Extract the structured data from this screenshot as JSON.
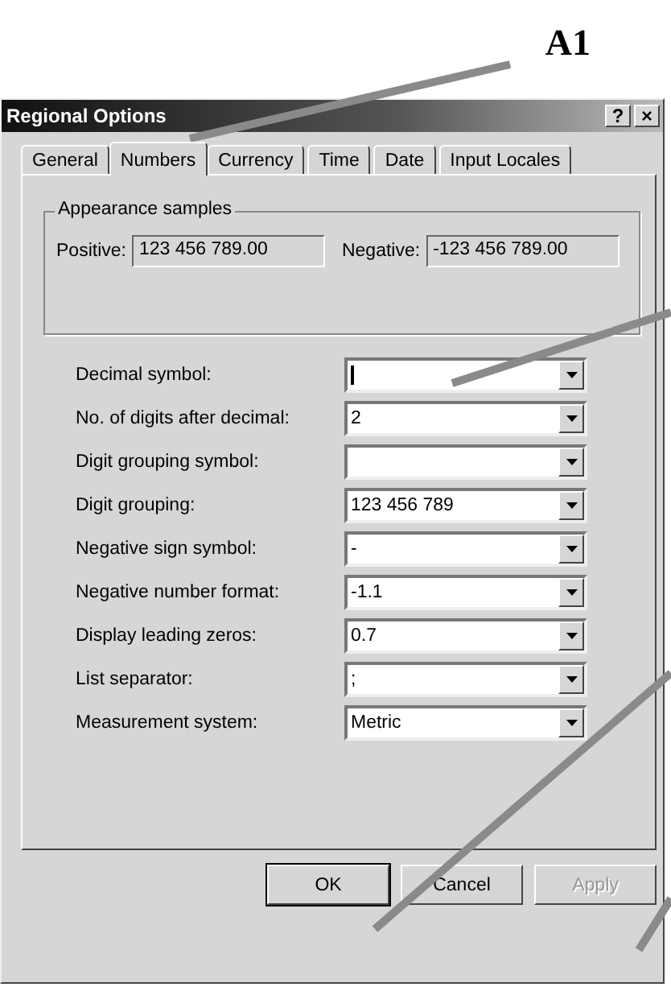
{
  "annotation": {
    "label": "A1"
  },
  "window": {
    "title": "Regional Options",
    "help_button": "?",
    "close_button": "×"
  },
  "tabs": [
    {
      "label": "General",
      "selected": false
    },
    {
      "label": "Numbers",
      "selected": true
    },
    {
      "label": "Currency",
      "selected": false
    },
    {
      "label": "Time",
      "selected": false
    },
    {
      "label": "Date",
      "selected": false
    },
    {
      "label": "Input Locales",
      "selected": false
    }
  ],
  "appearance_samples": {
    "title": "Appearance samples",
    "positive": {
      "label": "Positive:",
      "value": "123 456 789.00"
    },
    "negative": {
      "label": "Negative:",
      "value": "-123 456 789.00"
    }
  },
  "settings": [
    {
      "label": "Decimal symbol:",
      "focused": true
    },
    {
      "label": "No. of digits after decimal:",
      "value": "2",
      "focused": false
    },
    {
      "label": "Digit grouping symbol:",
      "focused": false
    },
    {
      "label": "Digit grouping:",
      "value": "123 456 789",
      "focused": false
    },
    {
      "label": "Negative sign symbol:",
      "value": "-",
      "focused": false
    },
    {
      "label": "Negative number format:",
      "value": "-1.1",
      "focused": false
    },
    {
      "label": "Display leading zeros:",
      "value": "0.7",
      "focused": false
    },
    {
      "label": "List separator:",
      "value": ";",
      "focused": false
    },
    {
      "label": "Measurement system:",
      "value": "Metric",
      "focused": false
    }
  ],
  "buttons": [
    {
      "label": "OK",
      "disabled": false,
      "default": true
    },
    {
      "label": "Cancel",
      "disabled": false,
      "default": false
    },
    {
      "label": "Apply",
      "disabled": true,
      "default": false
    }
  ]
}
